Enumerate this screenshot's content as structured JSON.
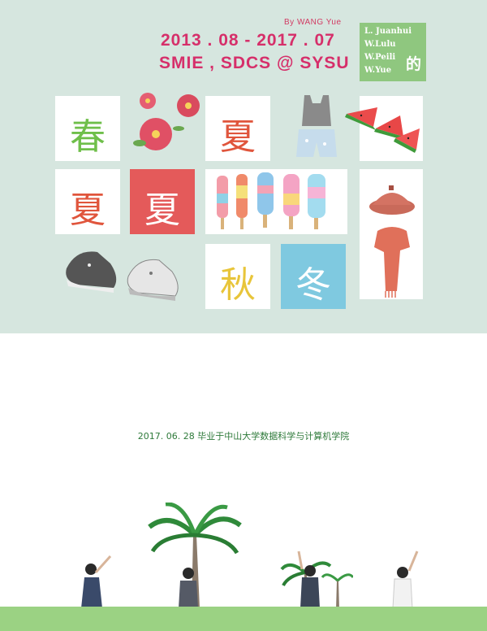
{
  "header": {
    "byline": "By WANG Yue",
    "date_range": "2013 . 08 - 2017 . 07",
    "schools": "SMIE , SDCS @ SYSU"
  },
  "names": {
    "list": [
      "L. Juanhui",
      "W.Lulu",
      "W.Peili",
      "W.Yue"
    ],
    "suffix": "的"
  },
  "seasons": {
    "spring": "春",
    "summer_top": "夏",
    "summer_left": "夏",
    "summer_red": "夏",
    "autumn": "秋",
    "winter": "冬"
  },
  "caption": "2017. 06. 28  毕业于中山大学数据科学与计算机学院",
  "colors": {
    "background_top": "#d6e6df",
    "accent_pink": "#d62f6a",
    "names_green": "#8fc77f",
    "spring_green": "#6fbf4a",
    "summer_orange": "#e0553c",
    "red_card": "#e45a5a",
    "autumn_yellow": "#e8c53a",
    "winter_blue": "#7fc9e0",
    "ground_green": "#9bd283",
    "caption_green": "#2e7a3a"
  }
}
